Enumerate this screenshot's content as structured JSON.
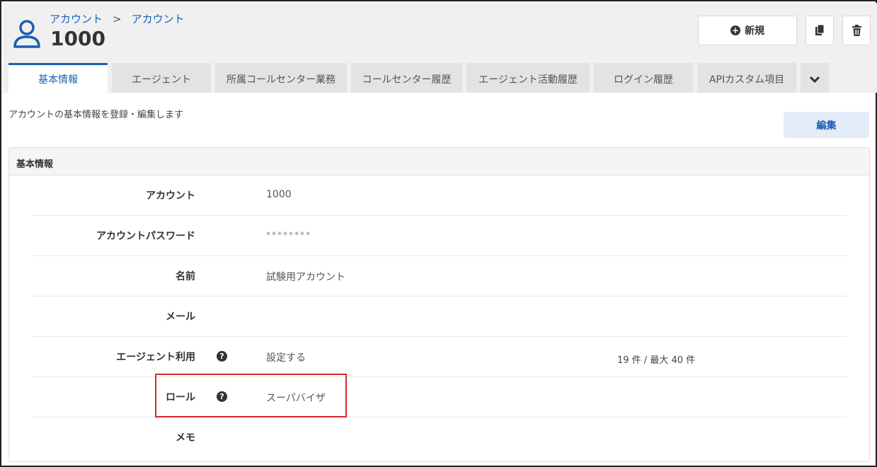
{
  "breadcrumb": {
    "item1": "アカウント",
    "separator": ">",
    "item2": "アカウント"
  },
  "title": "1000",
  "header_buttons": {
    "new_label": "新規"
  },
  "tabs": [
    {
      "label": "基本情報",
      "active": true
    },
    {
      "label": "エージェント"
    },
    {
      "label": "所属コールセンター業務"
    },
    {
      "label": "コールセンター履歴"
    },
    {
      "label": "エージェント活動履歴"
    },
    {
      "label": "ログイン履歴"
    },
    {
      "label": "APIカスタム項目"
    }
  ],
  "description": "アカウントの基本情報を登録・編集します",
  "edit_label": "編集",
  "panel": {
    "title": "基本情報",
    "rows": [
      {
        "label": "アカウント",
        "value": "1000"
      },
      {
        "label": "アカウントパスワード",
        "value": "********"
      },
      {
        "label": "名前",
        "value": "試験用アカウント"
      },
      {
        "label": "メール",
        "value": ""
      },
      {
        "label": "エージェント利用",
        "value": "設定する",
        "extra": "19 件 / 最大 40 件"
      },
      {
        "label": "ロール",
        "value": "スーパバイザ"
      },
      {
        "label": "メモ",
        "value": ""
      }
    ]
  },
  "colors": {
    "accent": "#1a5fb4",
    "highlight": "#d62828"
  }
}
